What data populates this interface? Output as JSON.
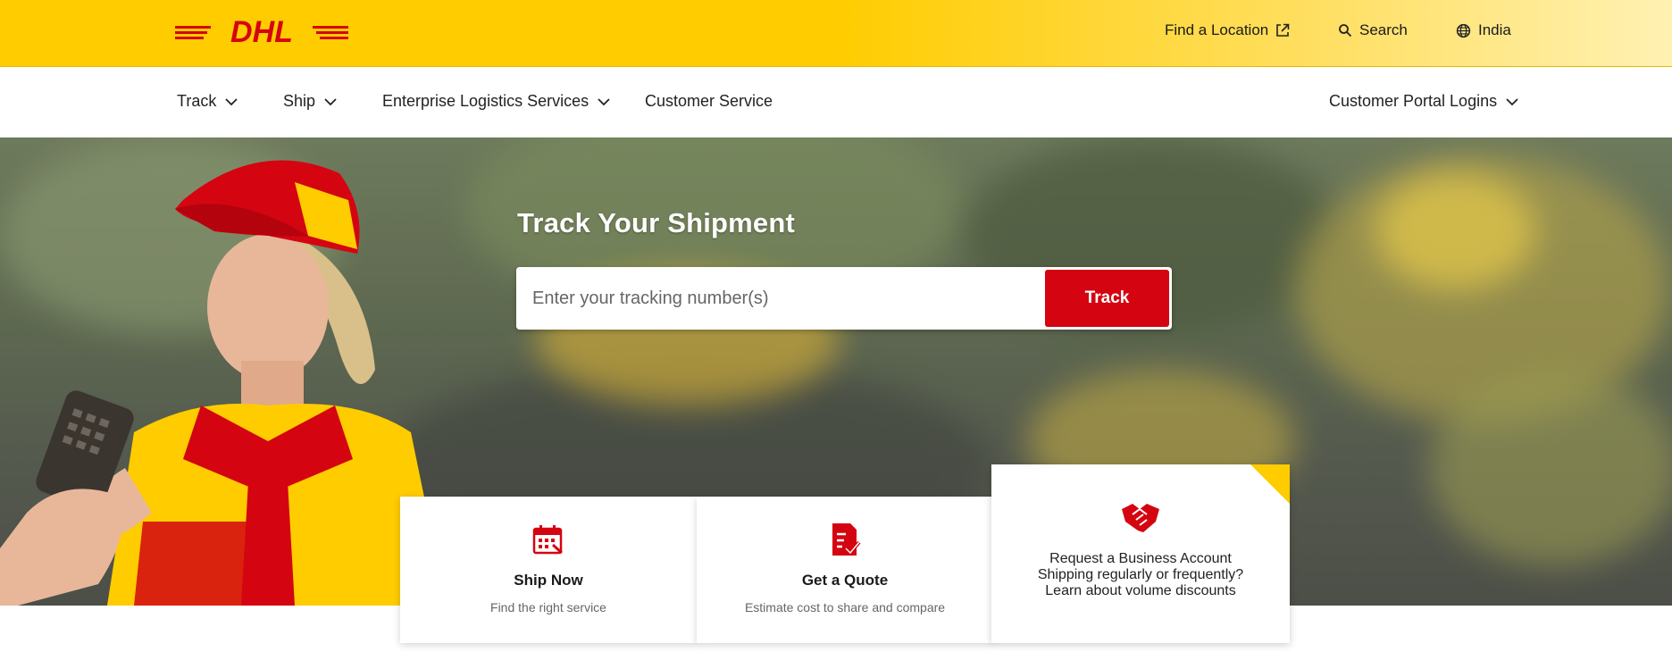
{
  "header": {
    "logo_text": "DHL",
    "utility": {
      "find_location": "Find a Location",
      "search": "Search",
      "country": "India"
    }
  },
  "nav": {
    "items": [
      {
        "label": "Track"
      },
      {
        "label": "Ship"
      },
      {
        "label": "Enterprise Logistics Services"
      },
      {
        "label": "Customer Service"
      }
    ],
    "portal": "Customer Portal Logins"
  },
  "hero": {
    "title": "Track Your Shipment",
    "tracking_placeholder": "Enter your tracking number(s)",
    "track_button": "Track"
  },
  "cards": [
    {
      "title": "Ship Now",
      "subtitle": "Find the right service",
      "icon": "calendar-icon"
    },
    {
      "title": "Get a Quote",
      "subtitle": "Estimate cost to share and compare",
      "icon": "quote-document-icon"
    },
    {
      "title": "Request a Business Account",
      "subtitle": "Shipping regularly or frequently? Learn about volume discounts",
      "icon": "handshake-icon"
    }
  ],
  "colors": {
    "brand_yellow": "#ffcc00",
    "brand_red": "#d40511"
  }
}
